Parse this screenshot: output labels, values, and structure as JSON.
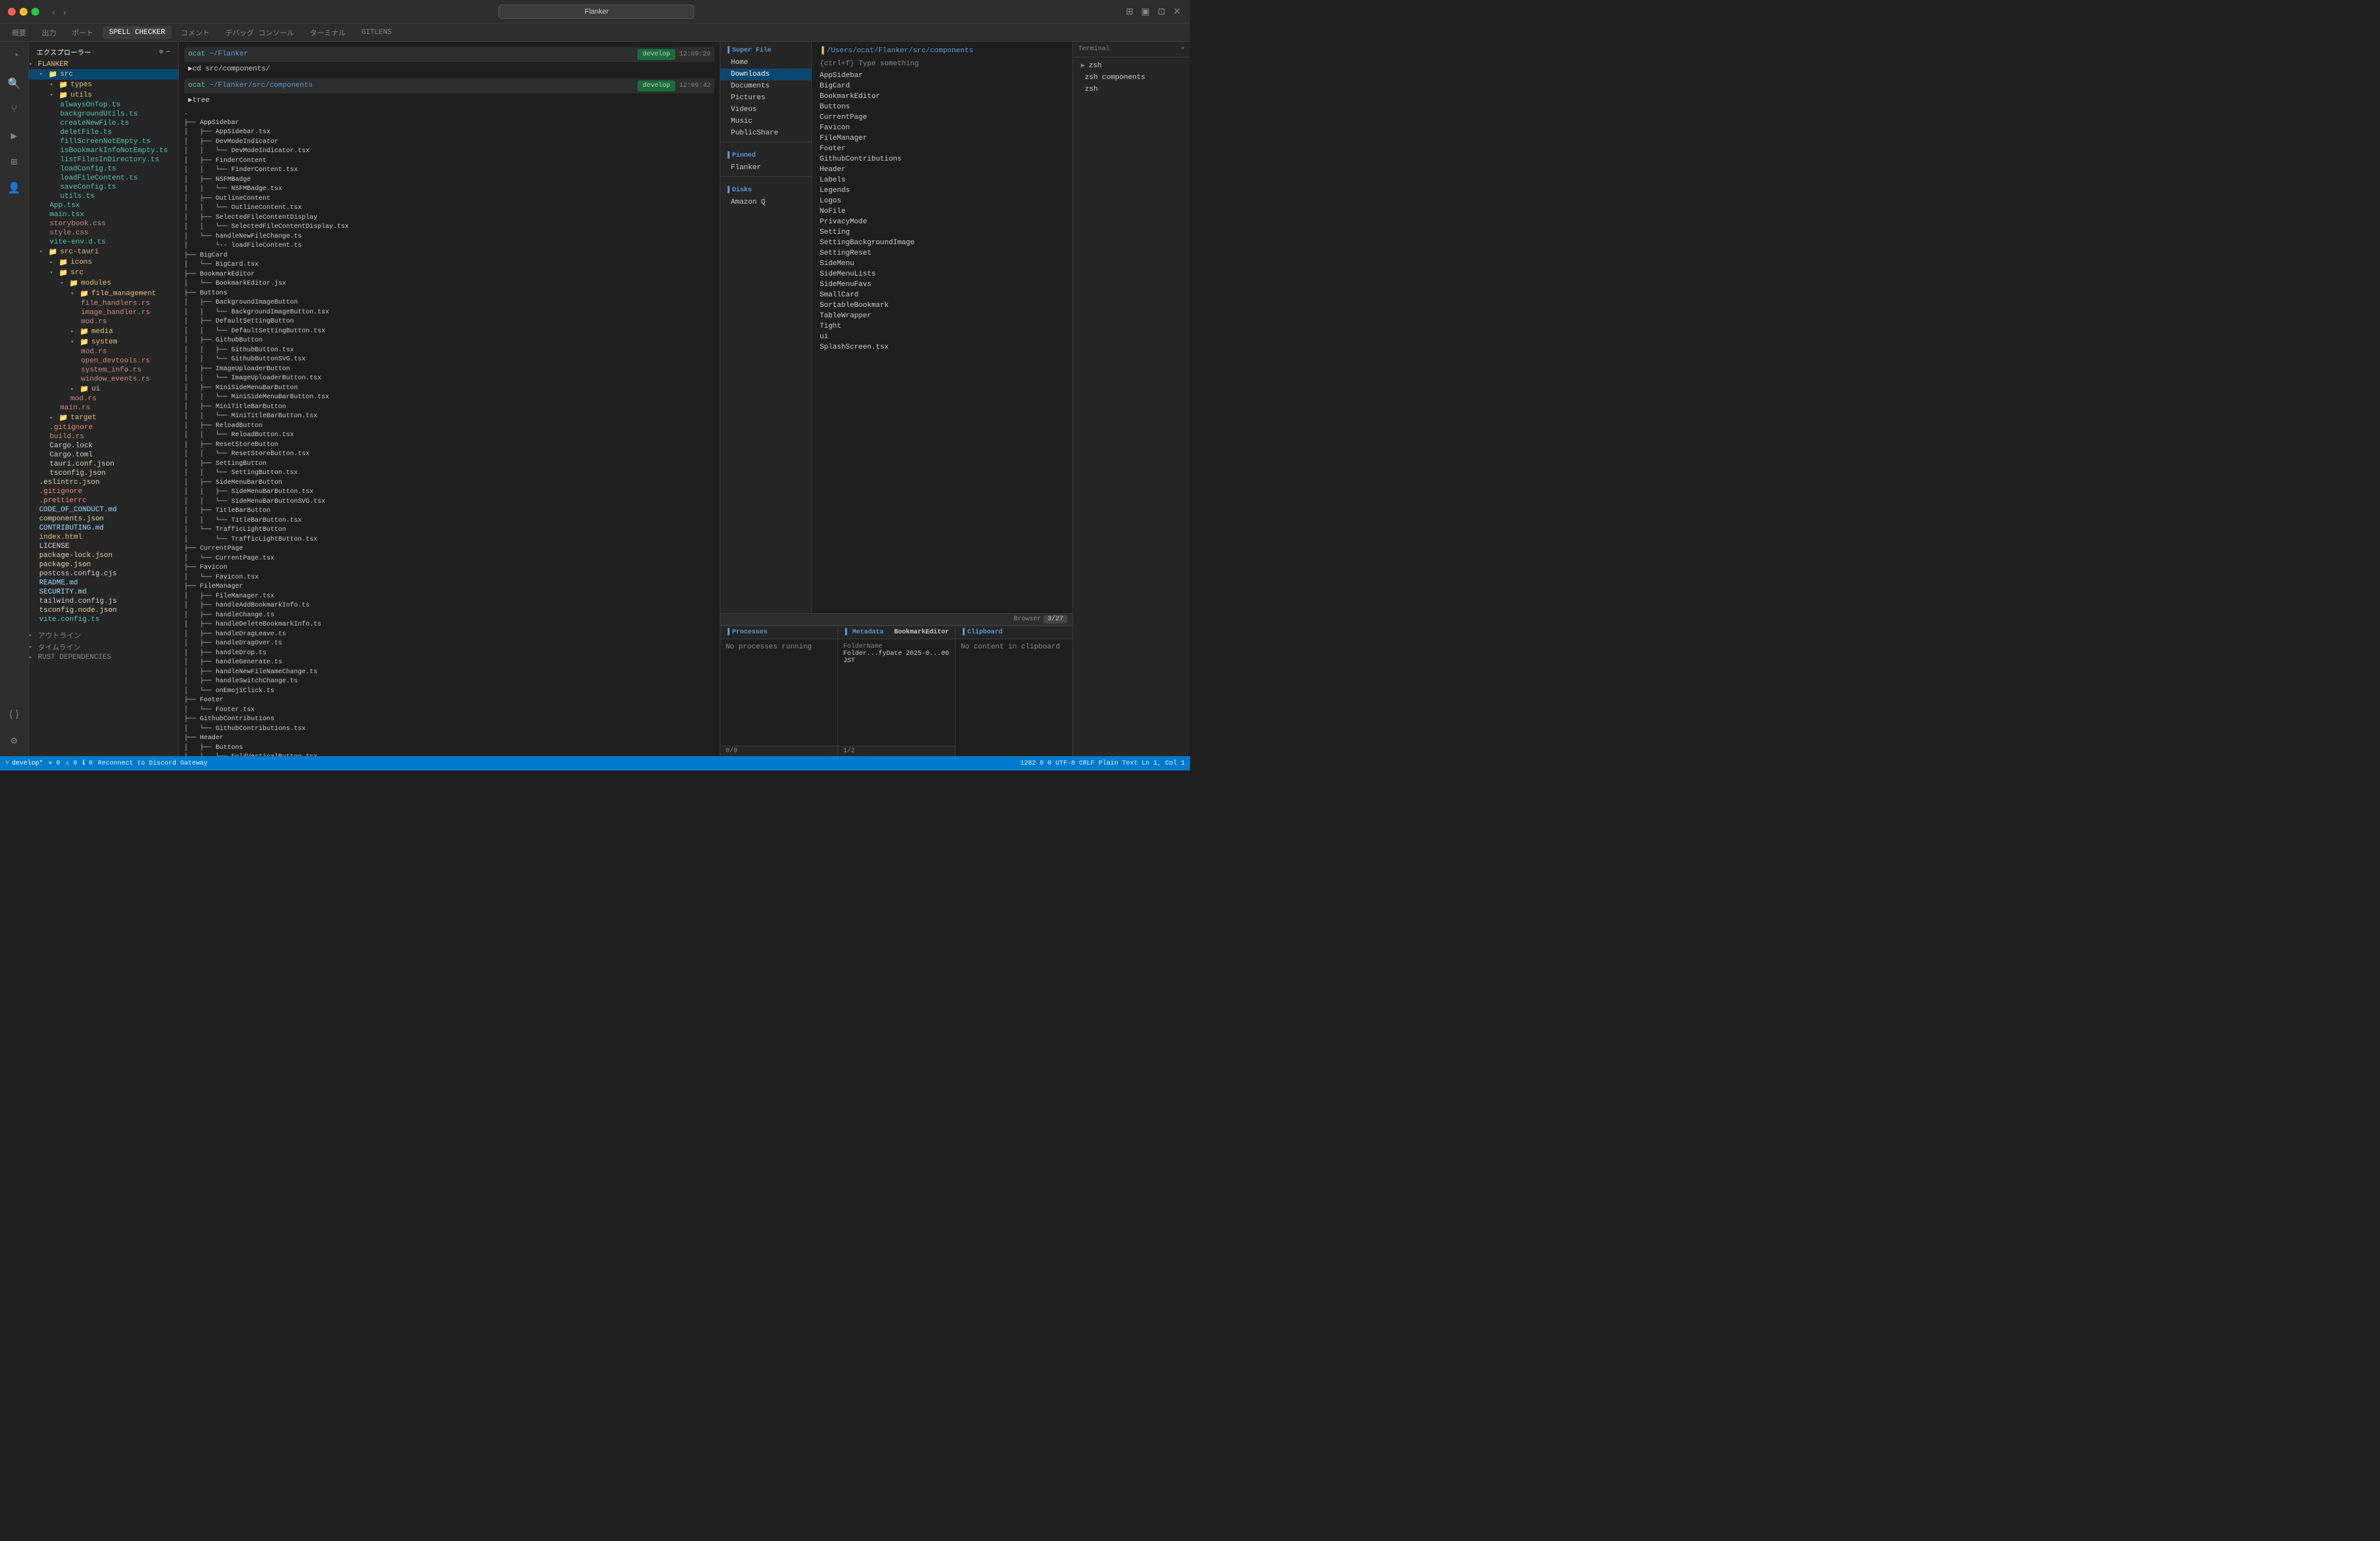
{
  "titlebar": {
    "search_placeholder": "Flanker",
    "search_value": "Flanker"
  },
  "tabs": {
    "items": [
      "概要",
      "出力",
      "ポート",
      "SPELL CHECKER",
      "コメント",
      "デバッグ コンソール",
      "ターミナル",
      "GITLENS"
    ]
  },
  "sidebar": {
    "title": "エクスプローラー",
    "project": "FLANKER",
    "src_folder": "src",
    "files": {
      "types": "types",
      "utils": "utils.ts",
      "alwaysOnTop": "alwaysOnTop.ts",
      "backgroundUtils": "backgroundUtils.ts",
      "createNewFile": "createNewFile.ts",
      "deletFile": "deletFile.ts",
      "fillScreenNotEmpty": "fillScreenNotEmpty.ts",
      "isBookmarkInfoNotEmpty": "isBookmarkInfoNotEmpty.ts",
      "listFilesInDirectory": "listFilesInDirectory.ts",
      "loadConfig": "loadConfig.ts",
      "loadFileContent": "loadFileContent.ts",
      "saveConfig": "saveConfig.ts",
      "App": "App.tsx",
      "main": "main.tsx",
      "storybook": "storybook.css",
      "style": "style.css",
      "vite_env": "vite-env.d.ts",
      "src_tauri": "src-tauri",
      "icons": "icons",
      "src2": "src",
      "modules": "modules",
      "file_management": "file_management",
      "file_handlers": "file_handlers.rs",
      "image_handler": "image_handler.rs",
      "mod": "mod.rs",
      "media": "media",
      "system": "system",
      "mod2": "mod.rs",
      "open_devtools": "open_devtools.rs",
      "system_info": "system_info.rs",
      "window_events": "window_events.rs",
      "ui": "ui",
      "mod3": "mod.rs",
      "main_rs": "main.rs",
      "target": "target",
      "gitignore2": ".gitignore",
      "build_rs": "build.rs",
      "cargo_lock": "Cargo.lock",
      "cargo_toml": "Cargo.toml",
      "tauri_conf": "tauri.conf.json",
      "tsconfig": "tsconfig.json",
      "eslintrc": ".eslintrc.json",
      "gitignore": ".gitignore",
      "prettierrc": ".prettierrc",
      "CODE_OF_CONDUCT": "CODE_OF_CONDUCT.md",
      "components": "components.json",
      "CONTRIBUTING": "CONTRIBUTING.md",
      "index_html": "index.html",
      "LICENSE": "LICENSE",
      "package_lock": "package-lock.json",
      "package": "package.json",
      "postcss_config": "postcss.config.cjs",
      "README": "README.md",
      "SECURITY": "SECURITY.md",
      "tailwind_config": "tailwind.config.js",
      "tsconfig_node": "tsconfig.node.json",
      "vite_config": "vite.config.ts",
      "アウトライン": "アウトライン",
      "タイムライン": "タイムライン",
      "RUST_DEPENDENCIES": "RUST DEPENDENCIES"
    }
  },
  "terminal": {
    "cmd1_path": "ocat ~/Flanker",
    "cmd1_badge": "develop",
    "cmd1_time": "12:09:29",
    "cmd2_path": "▶cd src/components/",
    "cmd3_path": "~/Flanker/src/components",
    "cmd3_badge": "develop",
    "cmd3_time": "12:09:42",
    "cmd4": "▶tree"
  },
  "super_file": {
    "title": "Super File",
    "nav_sections": {
      "home": "Home",
      "downloads": "Downloads",
      "documents": "Documents",
      "pictures": "Pictures",
      "videos": "Videos",
      "music": "Music",
      "publicshare": "PublicShare"
    },
    "pinned": "Pinned",
    "pinned_items": [
      "Flanker"
    ],
    "disks": "Disks",
    "disk_items": [
      "Amazon Q"
    ]
  },
  "file_tree_panel": {
    "path": "/Users/ocat/Flanker/src/components",
    "prompt": "{ctrl+f} Type something",
    "files": [
      "AppSidebar",
      "BigCard",
      "BookmarkEditor",
      "Buttons",
      "CurrentPage",
      "Favicon",
      "FileManager",
      "Footer",
      "GithubContributions",
      "Header",
      "Labels",
      "Legends",
      "Logos",
      "NoFile",
      "PrivacyMode",
      "Setting",
      "SettingBackgroundImage",
      "SettingReset",
      "SideMenu",
      "SideMenuLists",
      "SideMenuFavs",
      "SmallCard",
      "SortableBookmark",
      "TableWrapper",
      "Tight",
      "ui",
      "SplashScreen.tsx"
    ]
  },
  "processes_panel": {
    "title": "Processes",
    "content": "No processes running",
    "footer": "0/0"
  },
  "metadata_panel": {
    "title": "Metadata",
    "folder_label": "FolderName",
    "folder_value": "Folder...fyDate 2025-0...00 JST",
    "footer": "1/2"
  },
  "bookmark_editor": {
    "title": "BookmarkEditor"
  },
  "clipboard_panel": {
    "title": "Clipboard",
    "content": "No content in clipboard",
    "browser_label": "Browser",
    "browser_pages": "3/27"
  },
  "far_right": {
    "items": [
      {
        "label": "zsh",
        "icon": "▶"
      },
      {
        "label": "zsh  components",
        "icon": " "
      },
      {
        "label": "zsh",
        "icon": " "
      }
    ]
  },
  "statusbar": {
    "branch": "develop*",
    "errors": "0",
    "warnings": "0",
    "info": "0",
    "reconnect": "Reconnect to Discord Gateway",
    "right_items": "1282  0 0  UTF-8  CRLF  Plain Text  Ln 1, Col 1"
  }
}
